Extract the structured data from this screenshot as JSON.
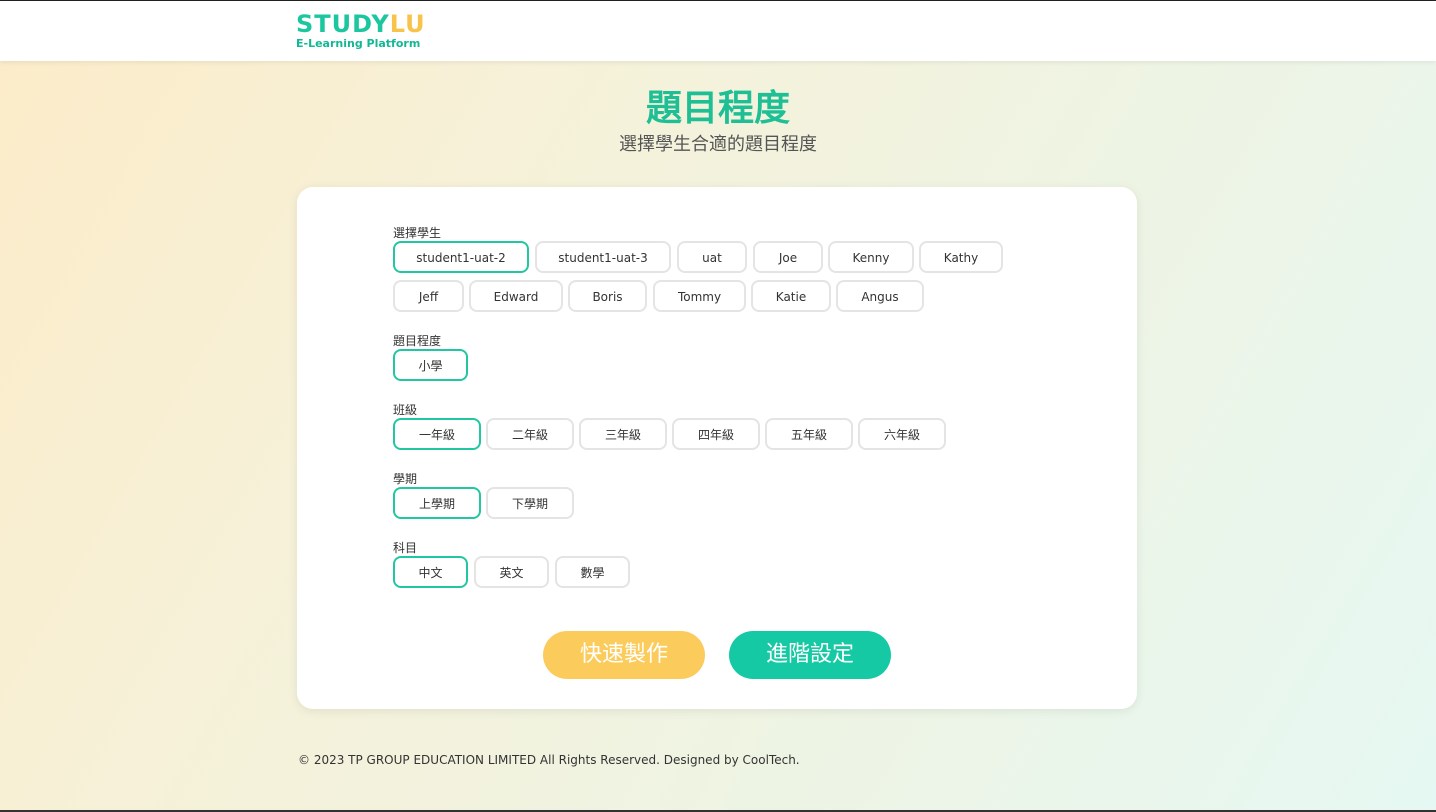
{
  "header": {
    "logo_part1": "STUDY",
    "logo_part2": "LU",
    "logo_tagline": "E-Learning Platform"
  },
  "page": {
    "title": "題目程度",
    "subtitle": "選擇學生合適的題目程度"
  },
  "form": {
    "student": {
      "label": "選擇學生",
      "options": [
        "student1-uat-2",
        "student1-uat-3",
        "uat",
        "Joe",
        "Kenny",
        "Kathy",
        "Jeff",
        "Edward",
        "Boris",
        "Tommy",
        "Katie",
        "Angus"
      ],
      "selected": "student1-uat-2"
    },
    "level": {
      "label": "題目程度",
      "options": [
        "小學"
      ],
      "selected": "小學"
    },
    "grade": {
      "label": "班級",
      "options": [
        "一年級",
        "二年級",
        "三年級",
        "四年級",
        "五年級",
        "六年級"
      ],
      "selected": "一年級"
    },
    "term": {
      "label": "學期",
      "options": [
        "上學期",
        "下學期"
      ],
      "selected": "上學期"
    },
    "subject": {
      "label": "科目",
      "options": [
        "中文",
        "英文",
        "數學"
      ],
      "selected": "中文"
    }
  },
  "actions": {
    "quick_label": "快速製作",
    "advanced_label": "進階設定"
  },
  "colors": {
    "accent_green": "#1cc7a0",
    "accent_yellow": "#fbcb5c"
  },
  "footer": {
    "copyright": "© 2023 TP GROUP EDUCATION LIMITED All Rights Reserved. Designed by CoolTech."
  }
}
